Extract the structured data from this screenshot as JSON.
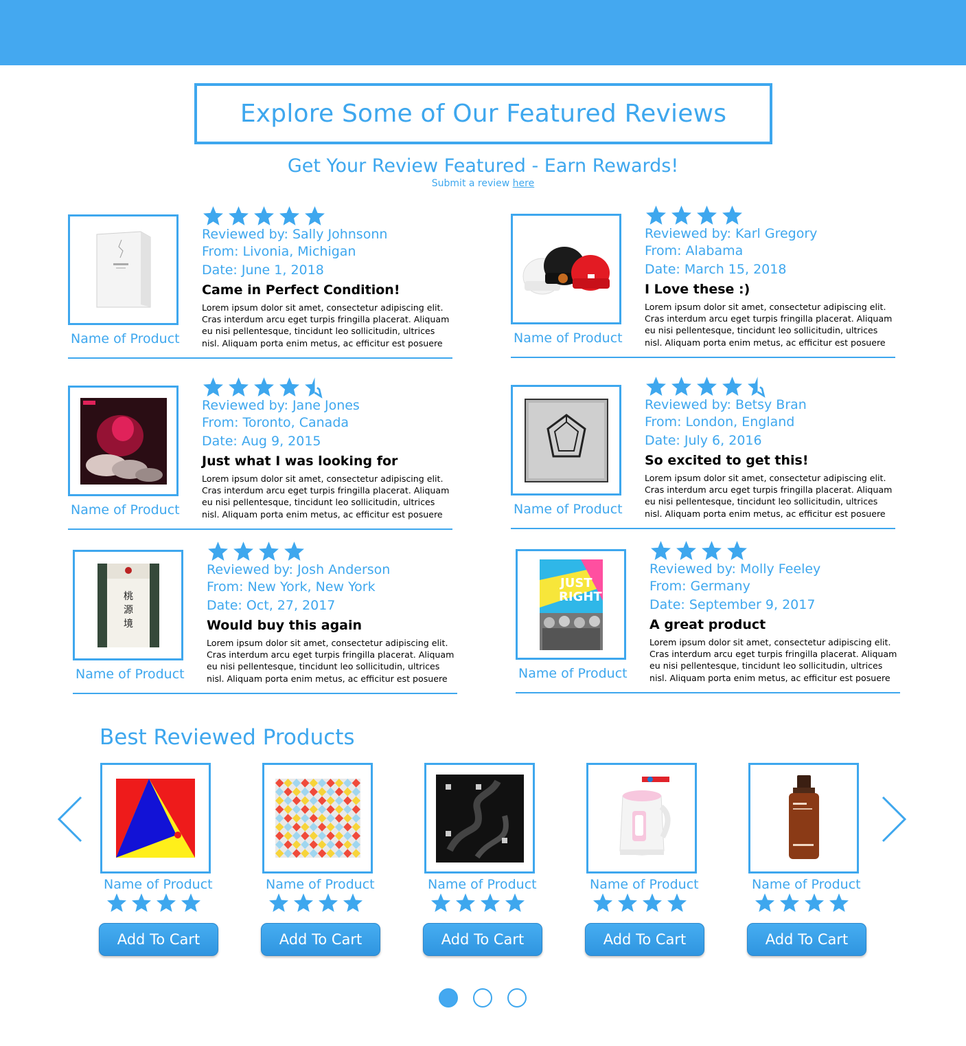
{
  "colors": {
    "accent": "#3ea7ee",
    "header_bar": "#44a8f0",
    "text_dark": "#000000"
  },
  "featured": {
    "title": "Explore Some of Our Featured Reviews",
    "subtitle": "Get Your Review Featured - Earn Rewards!",
    "submit_prefix": "Submit a review",
    "submit_link": "here"
  },
  "reviews": [
    {
      "product_name": "Name of Product",
      "rating": 5,
      "reviewer": "Reviewed by: Sally Johnsonn",
      "from": "From: Livonia, Michigan",
      "date": "Date: June 1, 2018",
      "headline": "Came in Perfect Condition!",
      "body": "Lorem ipsum dolor sit amet, consectetur adipiscing elit. Cras interdum arcu eget turpis fringilla placerat. Aliquam eu nisi pellentesque, tincidunt leo sollicitudin, ultrices nisl. Aliquam porta enim metus, ac efficitur est posuere",
      "image": "white-album-box"
    },
    {
      "product_name": "Name of Product",
      "rating": 4,
      "reviewer": "Reviewed by: Karl Gregory",
      "from": "From: Alabama",
      "date": "Date: March 15, 2018",
      "headline": "I Love these :)",
      "body": "Lorem ipsum dolor sit amet, consectetur adipiscing elit. Cras interdum arcu eget turpis fringilla placerat. Aliquam eu nisi pellentesque, tincidunt leo sollicitudin, ultrices nisl. Aliquam porta enim metus, ac efficitur est posuere",
      "image": "beanies"
    },
    {
      "product_name": "Name of Product",
      "rating": 4.5,
      "reviewer": "Reviewed by: Jane Jones",
      "from": "From: Toronto, Canada",
      "date": "Date: Aug 9, 2015",
      "headline": "Just what I was looking for",
      "body": "Lorem ipsum dolor sit amet, consectetur adipiscing elit. Cras interdum arcu eget turpis fringilla placerat. Aliquam eu nisi pellentesque, tincidunt leo sollicitudin, ultrices nisl. Aliquam porta enim metus, ac efficitur est posuere",
      "image": "red-explosion-album"
    },
    {
      "product_name": "Name of Product",
      "rating": 4.5,
      "reviewer": "Reviewed by: Betsy Bran",
      "from": "From: London, England",
      "date": "Date: July 6, 2016",
      "headline": "So excited to get this!",
      "body": "Lorem ipsum dolor sit amet, consectetur adipiscing elit. Cras interdum arcu eget turpis fringilla placerat. Aliquam eu nisi pellentesque, tincidunt leo sollicitudin, ultrices nisl. Aliquam porta enim metus, ac efficitur est posuere",
      "image": "silver-pentagon-album"
    },
    {
      "product_name": "Name of Product",
      "rating": 4,
      "reviewer": "Reviewed by: Josh Anderson",
      "from": "From: New York, New York",
      "date": "Date: Oct, 27, 2017",
      "headline": "Would buy this again",
      "body": "Lorem ipsum dolor sit amet, consectetur adipiscing elit. Cras interdum arcu eget turpis fringilla placerat. Aliquam eu nisi pellentesque, tincidunt leo sollicitudin, ultrices nisl. Aliquam porta enim metus, ac efficitur est posuere",
      "image": "green-scroll-album"
    },
    {
      "product_name": "Name of Product",
      "rating": 4,
      "reviewer": "Reviewed by: Molly Feeley",
      "from": "From: Germany",
      "date": "Date: September 9, 2017",
      "headline": "A great product",
      "body": "Lorem ipsum dolor sit amet, consectetur adipiscing elit. Cras interdum arcu eget turpis fringilla placerat. Aliquam eu nisi pellentesque, tincidunt leo sollicitudin, ultrices nisl. Aliquam porta enim metus, ac efficitur est posuere",
      "image": "just-right-album"
    }
  ],
  "best": {
    "title": "Best Reviewed Products",
    "prev_icon": "chevron-left-icon",
    "next_icon": "chevron-right-icon",
    "products": [
      {
        "name": "Name of Product",
        "rating": 4,
        "button": "Add To Cart",
        "image": "red-blue-yellow-album"
      },
      {
        "name": "Name of Product",
        "rating": 4,
        "button": "Add To Cart",
        "image": "colorful-puzzle-album"
      },
      {
        "name": "Name of Product",
        "rating": 4,
        "button": "Add To Cart",
        "image": "black-smoke-album"
      },
      {
        "name": "Name of Product",
        "rating": 4,
        "button": "Add To Cart",
        "image": "electric-kettle"
      },
      {
        "name": "Name of Product",
        "rating": 4,
        "button": "Add To Cart",
        "image": "brown-skincare-bottle"
      }
    ],
    "pages": 3,
    "active_page": 1
  }
}
